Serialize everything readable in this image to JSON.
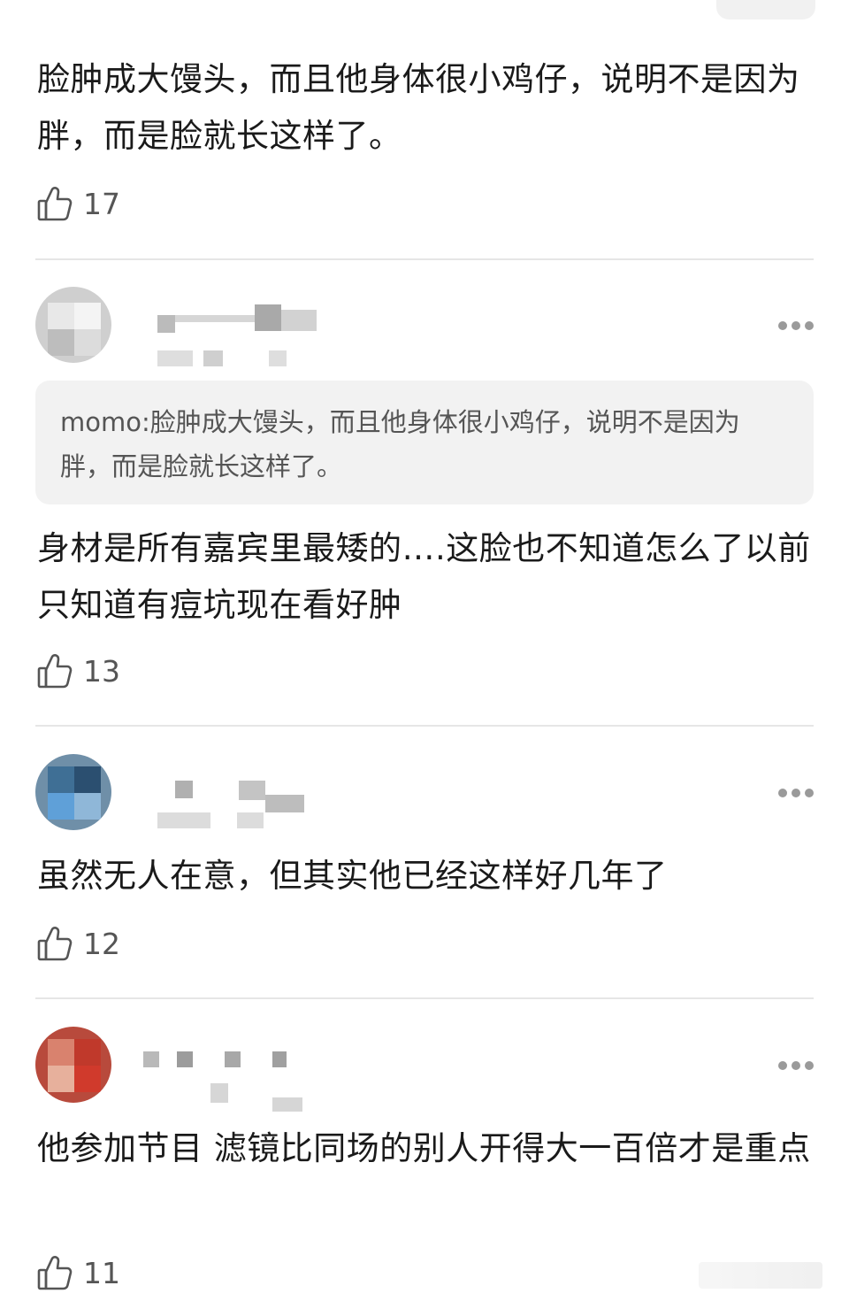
{
  "comments": [
    {
      "text": "脸肿成大馒头，而且他身体很小鸡仔，说明不是因为胖，而是脸就长这样了。",
      "likes": "17"
    },
    {
      "quote": "momo:脸肿成大馒头，而且他身体很小鸡仔，说明不是因为胖，而是脸就长这样了。",
      "text": "身材是所有嘉宾里最矮的….这脸也不知道怎么了以前只知道有痘坑现在看好肿",
      "likes": "13"
    },
    {
      "text": "虽然无人在意，但其实他已经这样好几年了",
      "likes": "12"
    },
    {
      "text": "他参加节目 滤镜比同场的别人开得大一百倍才是重点",
      "likes": "11"
    }
  ],
  "icons": {
    "like": "thumbs-up-icon",
    "more": "more-dots-icon"
  }
}
